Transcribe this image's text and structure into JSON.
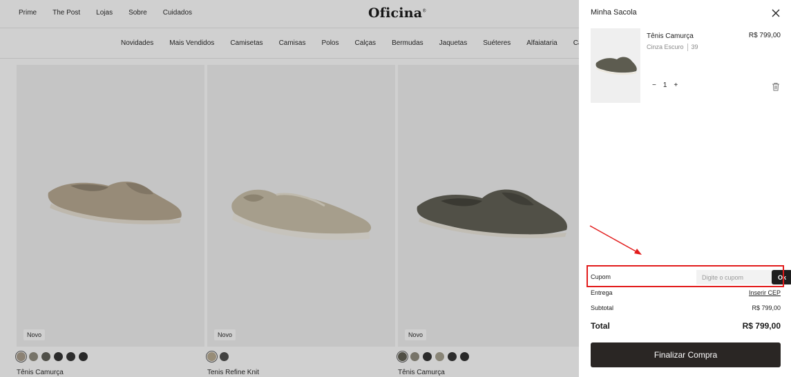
{
  "header": {
    "top_links": [
      "Prime",
      "The Post",
      "Lojas",
      "Sobre",
      "Cuidados"
    ],
    "logo": "Oficina",
    "logo_mark": "®",
    "categories": [
      "Novidades",
      "Mais Vendidos",
      "Camisetas",
      "Camisas",
      "Polos",
      "Calças",
      "Bermudas",
      "Jaquetas",
      "Suéteres",
      "Alfaiataria",
      "Calça"
    ]
  },
  "products": [
    {
      "name": "Tênis Camurça",
      "badge": "Novo",
      "swatches": [
        "#a89c8a",
        "#8e8a7c",
        "#5c5b52",
        "#2c2c2c",
        "#2f2f2f",
        "#2a2a2a"
      ],
      "shoe_color": "#b6a78f"
    },
    {
      "name": "Tenis Refine Knit",
      "badge": "Novo",
      "swatches": [
        "#b8a98f",
        "#4a4a48"
      ],
      "shoe_color": "#c9bfa8"
    },
    {
      "name": "Tênis Camurça",
      "badge": "Novo",
      "swatches": [
        "#5b5a4e",
        "#8e8a7c",
        "#2c2c2c",
        "#a59f8e",
        "#2f2f2f",
        "#2a2a2a"
      ],
      "shoe_color": "#5d5c50"
    }
  ],
  "bag": {
    "title": "Minha Sacola",
    "item": {
      "name": "Tênis Camurça",
      "color": "Cinza Escuro",
      "size": "39",
      "price": "R$ 799,00",
      "quantity": "1",
      "minus": "−",
      "plus": "+"
    },
    "coupon": {
      "label": "Cupom",
      "placeholder": "Digite o cupom",
      "button": "Ok"
    },
    "delivery": {
      "label": "Entrega",
      "link": "Inserir CEP"
    },
    "subtotal": {
      "label": "Subtotal",
      "value": "R$ 799,00"
    },
    "total": {
      "label": "Total",
      "value": "R$ 799,00"
    },
    "checkout": "Finalizar Compra"
  },
  "colors": {
    "annotation": "#e21b1b",
    "checkout_bg": "#2a2624"
  }
}
